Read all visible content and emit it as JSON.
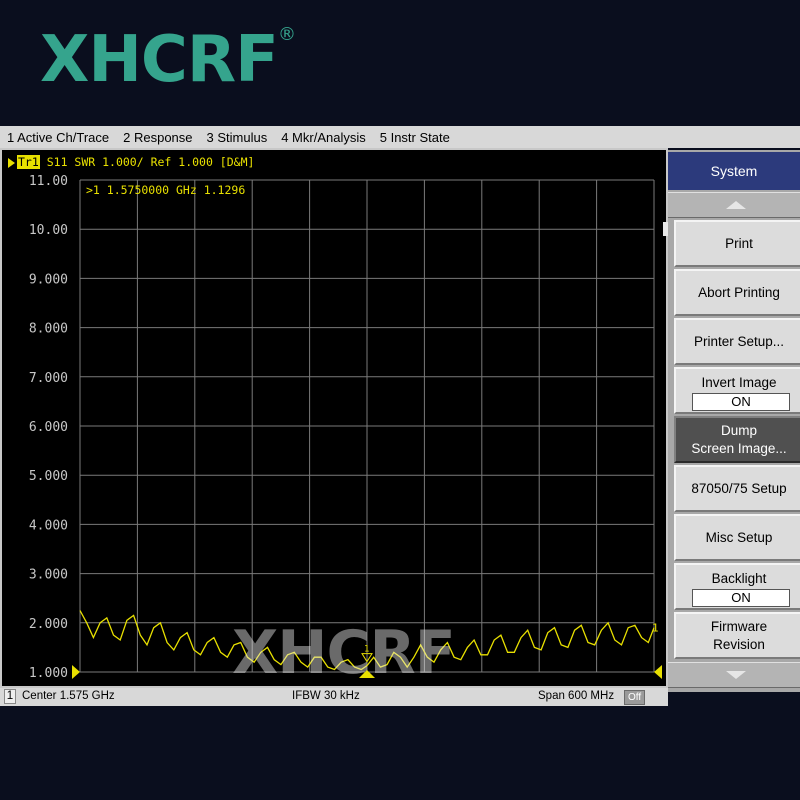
{
  "brand": {
    "logo": "XHCRF",
    "registered": "®",
    "watermark": "XHCRF",
    "color": "#35a48d"
  },
  "menu": [
    {
      "label": "1 Active Ch/Trace"
    },
    {
      "label": "2 Response"
    },
    {
      "label": "3 Stimulus"
    },
    {
      "label": "4 Mkr/Analysis"
    },
    {
      "label": "5 Instr State"
    }
  ],
  "trace": {
    "id": "Tr1",
    "description": "S11  SWR 1.000/ Ref 1.000 [D&M]",
    "color": "#e8e000"
  },
  "marker": {
    "readout": ">1  1.5750000 GHz  1.1296",
    "number": "1"
  },
  "status": {
    "channel": "1",
    "center": "Center 1.575 GHz",
    "ifbw": "IFBW 30 kHz",
    "span": "Span 600 MHz",
    "off": "Off"
  },
  "softkeys": {
    "title": "System",
    "items": [
      {
        "label": "Print"
      },
      {
        "label": "Abort Printing"
      },
      {
        "label": "Printer Setup..."
      },
      {
        "label": "Invert Image",
        "value": "ON"
      },
      {
        "label": "Dump\nScreen Image..."
      },
      {
        "label": "87050/75 Setup"
      },
      {
        "label": "Misc Setup"
      },
      {
        "label": "Backlight",
        "value": "ON"
      },
      {
        "label": "Firmware\nRevision"
      }
    ]
  },
  "chart_data": {
    "type": "line",
    "title": "",
    "xlabel": "",
    "ylabel": "",
    "y_tick_labels": [
      "11.00",
      "10.00",
      "9.000",
      "8.000",
      "7.000",
      "6.000",
      "5.000",
      "4.000",
      "3.000",
      "2.000",
      "1.000"
    ],
    "ylim": [
      1.0,
      11.0
    ],
    "xlim": [
      1.275,
      1.875
    ],
    "x_unit": "GHz",
    "grid": true,
    "series": [
      {
        "x": [
          1.275,
          1.282,
          1.289,
          1.296,
          1.303,
          1.31,
          1.317,
          1.324,
          1.331,
          1.338,
          1.345,
          1.352,
          1.359,
          1.366,
          1.373,
          1.38,
          1.387,
          1.394,
          1.401,
          1.408,
          1.415,
          1.422,
          1.429,
          1.436,
          1.443,
          1.45,
          1.457,
          1.464,
          1.471,
          1.478,
          1.485,
          1.492,
          1.499,
          1.506,
          1.513,
          1.52,
          1.527,
          1.534,
          1.541,
          1.548,
          1.555,
          1.562,
          1.569,
          1.575,
          1.582,
          1.589,
          1.596,
          1.603,
          1.61,
          1.617,
          1.624,
          1.631,
          1.638,
          1.645,
          1.652,
          1.659,
          1.666,
          1.673,
          1.68,
          1.687,
          1.694,
          1.701,
          1.708,
          1.715,
          1.722,
          1.729,
          1.736,
          1.743,
          1.75,
          1.757,
          1.764,
          1.771,
          1.778,
          1.785,
          1.792,
          1.799,
          1.806,
          1.813,
          1.82,
          1.827,
          1.834,
          1.841,
          1.848,
          1.855,
          1.862,
          1.869,
          1.875
        ],
        "y": [
          2.25,
          2.0,
          1.7,
          2.0,
          2.1,
          1.75,
          1.65,
          2.05,
          2.15,
          1.75,
          1.55,
          1.9,
          2.0,
          1.6,
          1.45,
          1.7,
          1.8,
          1.45,
          1.35,
          1.6,
          1.7,
          1.4,
          1.3,
          1.55,
          1.6,
          1.3,
          1.2,
          1.4,
          1.5,
          1.25,
          1.15,
          1.35,
          1.4,
          1.2,
          1.1,
          1.3,
          1.3,
          1.1,
          1.05,
          1.2,
          1.25,
          1.1,
          1.05,
          1.13,
          1.3,
          1.1,
          1.15,
          1.4,
          1.3,
          1.1,
          1.3,
          1.55,
          1.3,
          1.2,
          1.45,
          1.6,
          1.3,
          1.25,
          1.5,
          1.65,
          1.35,
          1.35,
          1.65,
          1.75,
          1.4,
          1.4,
          1.7,
          1.85,
          1.5,
          1.45,
          1.8,
          1.9,
          1.55,
          1.5,
          1.85,
          1.95,
          1.6,
          1.55,
          1.85,
          2.0,
          1.65,
          1.55,
          1.9,
          1.95,
          1.7,
          1.6,
          1.9
        ]
      }
    ],
    "markers": [
      {
        "number": "1",
        "x": 1.575,
        "y": 1.1296
      }
    ]
  }
}
